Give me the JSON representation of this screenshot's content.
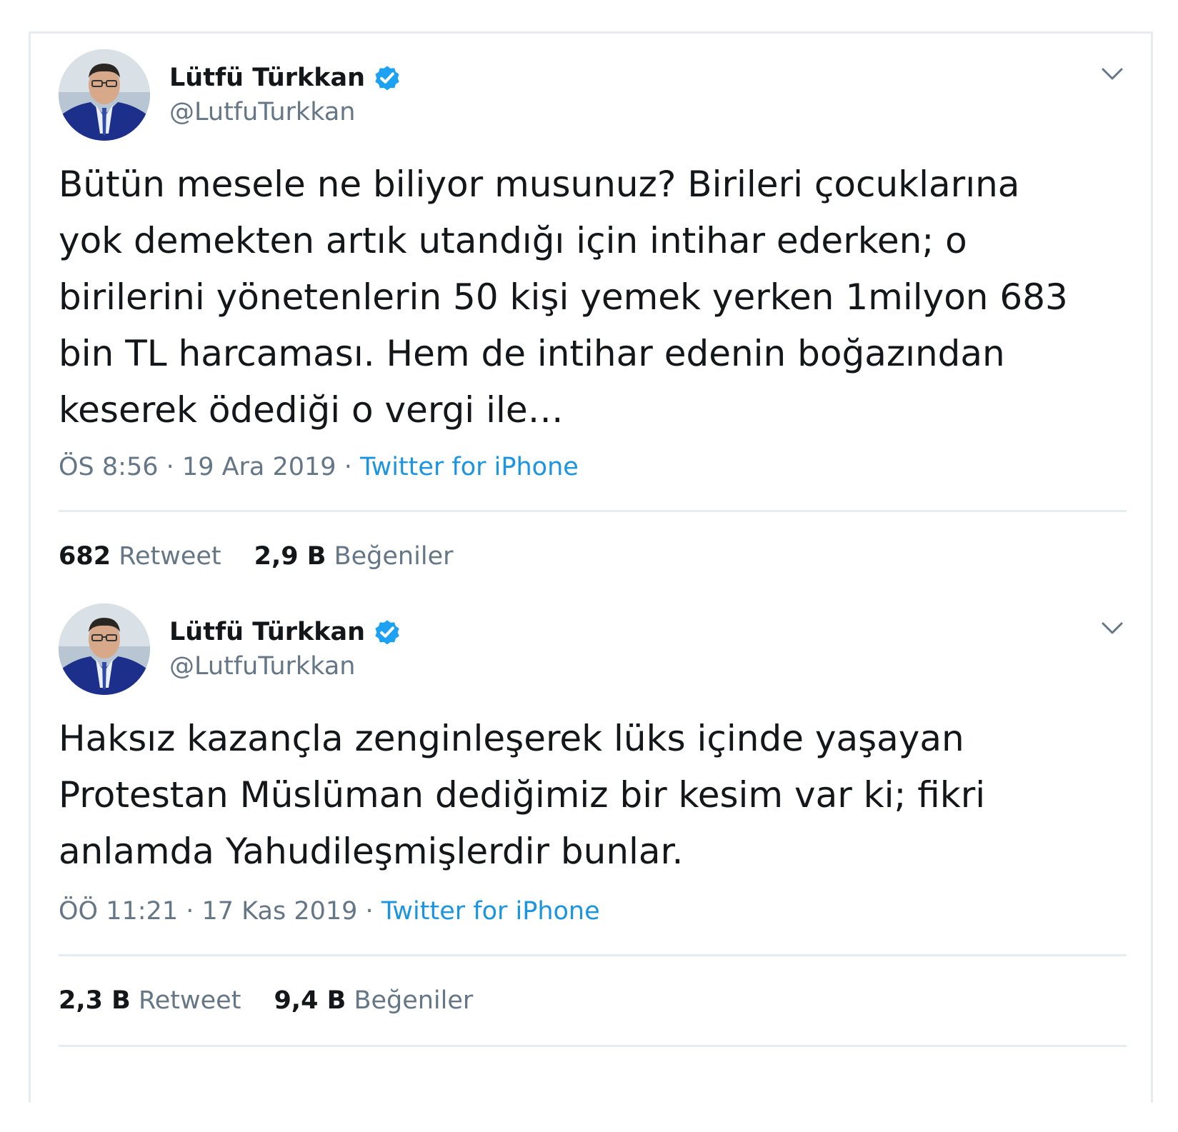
{
  "tweets": [
    {
      "author": {
        "display_name": "Lütfü Türkkan",
        "handle": "@LutfuTurkkan",
        "verified_icon": "verified-badge-icon",
        "avatar": "profile-photo"
      },
      "text": "Bütün mesele ne biliyor musunuz? Birileri çocuklarına\nyok demekten artık utandığı için intihar ederken; o\nbirilerini yönetenlerin 50 kişi yemek yerken 1milyon 683\nbin TL harcaması. Hem de intihar edenin boğazından\nkeserek ödediği o vergi ile…",
      "time": "ÖS 8:56",
      "separator": "·",
      "date": "19 Ara 2019",
      "source": "Twitter for iPhone",
      "retweet_count": "682",
      "retweet_label": "Retweet",
      "like_count": "2,9 B",
      "like_label": "Beğeniler"
    },
    {
      "author": {
        "display_name": "Lütfü Türkkan",
        "handle": "@LutfuTurkkan",
        "verified_icon": "verified-badge-icon",
        "avatar": "profile-photo"
      },
      "text": "Haksız kazançla zenginleşerek lüks içinde yaşayan\nProtestan Müslüman dediğimiz bir kesim var ki; fikri\nanlamda Yahudileşmişlerdir bunlar.",
      "time": "ÖÖ 11:21",
      "separator": "·",
      "date": "17 Kas 2019",
      "source": "Twitter for iPhone",
      "retweet_count": "2,3 B",
      "retweet_label": "Retweet",
      "like_count": "9,4 B",
      "like_label": "Beğeniler"
    }
  ],
  "colors": {
    "text_primary": "#14171a",
    "text_secondary": "#657786",
    "link_blue": "#1b95e0",
    "verified_blue": "#1da1f2",
    "divider": "#e6ecf0"
  },
  "icons": {
    "menu": "chevron-down-icon",
    "verified": "verified-badge-icon"
  }
}
